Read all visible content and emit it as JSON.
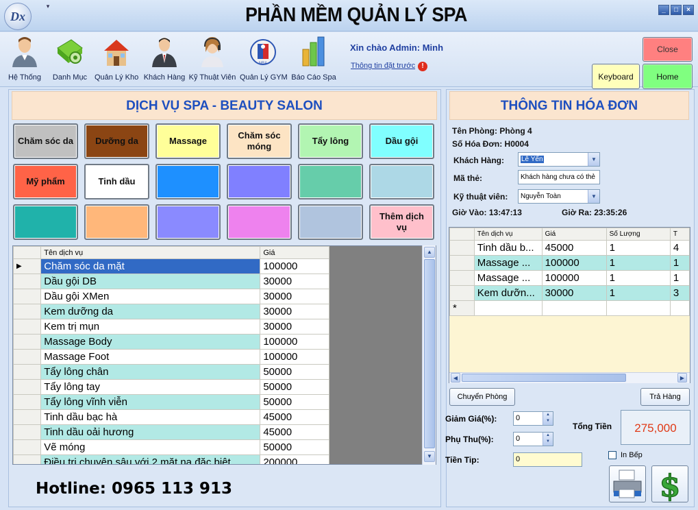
{
  "app": {
    "title": "PHẦN MỀM QUẢN LÝ SPA",
    "logo_text": "Dx",
    "qat_arrow": "▾"
  },
  "window_controls": {
    "minimize": "_",
    "maximize": "□",
    "close": "×"
  },
  "ribbon": {
    "items": [
      {
        "label": "Hệ Thống",
        "icon": "user-system-icon"
      },
      {
        "label": "Danh Mục",
        "icon": "catalog-gear-icon"
      },
      {
        "label": "Quản Lý Kho",
        "icon": "warehouse-house-icon"
      },
      {
        "label": "Khách Hàng",
        "icon": "customer-businessman-icon"
      },
      {
        "label": "Kỹ Thuật Viên",
        "icon": "technician-headset-icon"
      },
      {
        "label": "Quản Lý GYM",
        "icon": "gym-ball-icon"
      },
      {
        "label": "Báo Cáo Spa",
        "icon": "report-bar-chart-icon"
      }
    ],
    "greeting": "Xin chào Admin: Minh",
    "booking_link": "Thông tin đặt trước",
    "warning_icon": "!"
  },
  "top_buttons": {
    "close": "Close",
    "keyboard": "Keyboard",
    "home": "Home"
  },
  "services_panel": {
    "title": "DỊCH VỤ SPA - BEAUTY SALON",
    "buttons": [
      {
        "label": "Chăm sóc da",
        "color": "#c0c0c0"
      },
      {
        "label": "Dưỡng da",
        "color": "#8b4513"
      },
      {
        "label": "Massage",
        "color": "#ffff99"
      },
      {
        "label": "Chăm sóc móng",
        "color": "#fde4c4"
      },
      {
        "label": "Tẩy lông",
        "color": "#b2f5b2"
      },
      {
        "label": "Dầu gội",
        "color": "#80ffff"
      },
      {
        "label": "Mỹ phẩm",
        "color": "#ff6347"
      },
      {
        "label": "Tinh dầu",
        "color": "#ffffff"
      },
      {
        "label": "",
        "color": "#1e90ff"
      },
      {
        "label": "",
        "color": "#8080ff"
      },
      {
        "label": "",
        "color": "#66cdaa"
      },
      {
        "label": "",
        "color": "#add8e6"
      },
      {
        "label": "",
        "color": "#20b2aa"
      },
      {
        "label": "",
        "color": "#ffb77a"
      },
      {
        "label": "",
        "color": "#8a8aff"
      },
      {
        "label": "",
        "color": "#ee82ee"
      },
      {
        "label": "",
        "color": "#b0c4de"
      },
      {
        "label": "Thêm dịch vụ",
        "color": "#ffc0cb"
      }
    ],
    "grid": {
      "columns": [
        "Tên dịch vụ",
        "Giá"
      ],
      "current_row_marker": "▶",
      "rows": [
        [
          "Chăm sóc da mặt",
          "100000"
        ],
        [
          "Dầu gội DB",
          "30000"
        ],
        [
          "Dầu gội XMen",
          "30000"
        ],
        [
          "Kem dưỡng da",
          "30000"
        ],
        [
          "Kem trị mụn",
          "30000"
        ],
        [
          "Massage Body",
          "100000"
        ],
        [
          "Massage Foot",
          "100000"
        ],
        [
          "Tẩy lông chân",
          "50000"
        ],
        [
          "Tẩy lông tay",
          "50000"
        ],
        [
          "Tẩy lông vĩnh viễn",
          "50000"
        ],
        [
          "Tinh dầu bạc hà",
          "45000"
        ],
        [
          "Tinh dầu oải hương",
          "45000"
        ],
        [
          "Vẽ móng",
          "50000"
        ],
        [
          "Điều trị chuyên sâu với 2 mặt nạ đặc biệt",
          "200000"
        ]
      ]
    },
    "hotline": "Hotline: 0965 113 913"
  },
  "invoice_panel": {
    "title": "THÔNG TIN HÓA ĐƠN",
    "room": "Tên Phòng: Phòng 4",
    "invoice_no": "Số Hóa Đơn: H0004",
    "customer_label": "Khách Hàng:",
    "customer_value": "Lê Yến",
    "card_label": "Mã thẻ:",
    "card_value": "Khách hàng chưa có thẻ",
    "technician_label": "Kỹ thuật viên:",
    "technician_value": "Nguyễn Toàn",
    "time_in": "Giờ Vào: 13:47:13",
    "time_out": "Giờ Ra: 23:35:26",
    "grid": {
      "columns": [
        "Tên dịch vụ",
        "Giá",
        "Số Lượng",
        "T"
      ],
      "new_row_marker": "*",
      "rows": [
        [
          "Tinh dầu b...",
          "45000",
          "1",
          "4"
        ],
        [
          "Massage ...",
          "100000",
          "1",
          "1"
        ],
        [
          "Massage ...",
          "100000",
          "1",
          "1"
        ],
        [
          "Kem dưỡn...",
          "30000",
          "1",
          "3"
        ]
      ]
    },
    "transfer_room": "Chuyển Phòng",
    "return_goods": "Trả Hàng",
    "discount_label": "Giảm Giá(%):",
    "discount_value": "0",
    "surcharge_label": "Phụ Thu(%):",
    "surcharge_value": "0",
    "tip_label": "Tiền Tip:",
    "tip_value": "0",
    "total_label": "Tổng Tiền",
    "total_value": "275,000",
    "kitchen_label": "In Bếp"
  }
}
